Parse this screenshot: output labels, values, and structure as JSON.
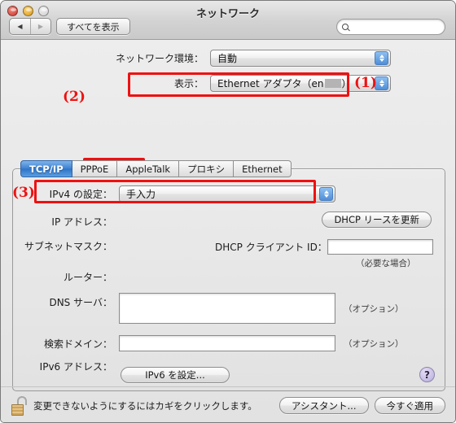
{
  "window": {
    "title": "ネットワーク",
    "traffic_lights": [
      "close",
      "minimize",
      "zoom"
    ]
  },
  "toolbar": {
    "back_glyph": "◀",
    "forward_glyph": "▶",
    "show_all_label": "すべてを表示",
    "search_value": "",
    "search_placeholder": ""
  },
  "popups": {
    "location": {
      "label": "ネットワーク環境：",
      "value": "自動"
    },
    "show": {
      "label": "表示：",
      "value_prefix": "Ethernet アダプタ（en",
      "value_suffix": "）",
      "redacted": true
    }
  },
  "annotations": [
    {
      "id": "1",
      "label": "(1)"
    },
    {
      "id": "2",
      "label": "(2)"
    },
    {
      "id": "3",
      "label": "(3)"
    }
  ],
  "tabs": [
    {
      "label": "TCP/IP",
      "active": true
    },
    {
      "label": "PPPoE",
      "active": false
    },
    {
      "label": "AppleTalk",
      "active": false
    },
    {
      "label": "プロキシ",
      "active": false
    },
    {
      "label": "Ethernet",
      "active": false
    }
  ],
  "panel": {
    "ipv4_config": {
      "label": "IPv4 の設定：",
      "value": "手入力"
    },
    "ip_address": {
      "label": "IP アドレス：",
      "value": ""
    },
    "subnet_mask": {
      "label": "サブネットマスク：",
      "value": ""
    },
    "router": {
      "label": "ルーター：",
      "value": ""
    },
    "dns_servers": {
      "label": "DNS サーバ：",
      "value": "",
      "hint": "（オプション）"
    },
    "search_domains": {
      "label": "検索ドメイン：",
      "value": "",
      "hint": "（オプション）"
    },
    "ipv6_address": {
      "label": "IPv6 アドレス：",
      "value": ""
    },
    "dhcp_renew_button": "DHCP リースを更新",
    "dhcp_client_id": {
      "label": "DHCP クライアント ID：",
      "value": "",
      "hint": "（必要な場合）"
    },
    "configure_ipv6_button": "IPv6 を設定...",
    "help_button": "?"
  },
  "footer": {
    "lock_icon": "open-padlock",
    "lock_text": "変更できないようにするにはカギをクリックします。",
    "assistant_button": "アシスタント...",
    "apply_button": "今すぐ適用"
  },
  "colors": {
    "annotation_red": "#ee1111",
    "active_tab_blue": "#3d82d2",
    "help_purple": "#b8aedb"
  }
}
